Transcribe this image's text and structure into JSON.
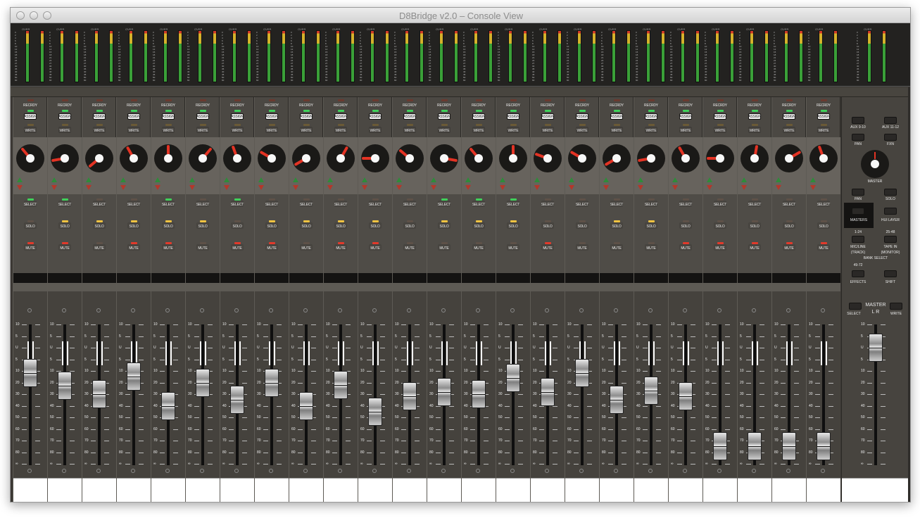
{
  "window": {
    "title": "D8Bridge v2.0 – Console View"
  },
  "meter_header_label": "OVER",
  "meter_ticks": [
    "0",
    "2",
    "4",
    "6",
    "8",
    "10",
    "12",
    "15",
    "18",
    "21",
    "24",
    "27",
    "30",
    "35",
    "40",
    "45",
    "50",
    "60"
  ],
  "buttons": {
    "recrdy": "RECRDY",
    "assign": "ASSIGN",
    "write": "WRITE",
    "select": "SELECT",
    "solo": "SOLO",
    "mute": "MUTE"
  },
  "fader_scale": [
    "10",
    "5",
    "U",
    "5",
    "10",
    "20",
    "30",
    "40",
    "50",
    "60",
    "70",
    "80",
    "∞"
  ],
  "channels": [
    {
      "knob_angle": -40,
      "fader_level_db": -12,
      "select_on": true,
      "solo_on": false,
      "mute_on": true
    },
    {
      "knob_angle": -100,
      "fader_level_db": -23,
      "select_on": true,
      "solo_on": true,
      "mute_on": true
    },
    {
      "knob_angle": -130,
      "fader_level_db": -30,
      "select_on": false,
      "solo_on": true,
      "mute_on": false
    },
    {
      "knob_angle": -30,
      "fader_level_db": -15,
      "select_on": false,
      "solo_on": true,
      "mute_on": true
    },
    {
      "knob_angle": 0,
      "fader_level_db": -40,
      "select_on": true,
      "solo_on": true,
      "mute_on": true
    },
    {
      "knob_angle": 40,
      "fader_level_db": -20,
      "select_on": false,
      "solo_on": true,
      "mute_on": false
    },
    {
      "knob_angle": -20,
      "fader_level_db": -35,
      "select_on": true,
      "solo_on": false,
      "mute_on": true
    },
    {
      "knob_angle": -60,
      "fader_level_db": -20,
      "select_on": false,
      "solo_on": true,
      "mute_on": true
    },
    {
      "knob_angle": -120,
      "fader_level_db": -40,
      "select_on": false,
      "solo_on": true,
      "mute_on": false
    },
    {
      "knob_angle": 30,
      "fader_level_db": -22,
      "select_on": false,
      "solo_on": true,
      "mute_on": true
    },
    {
      "knob_angle": -90,
      "fader_level_db": -45,
      "select_on": false,
      "solo_on": true,
      "mute_on": true
    },
    {
      "knob_angle": -50,
      "fader_level_db": -32,
      "select_on": false,
      "solo_on": false,
      "mute_on": false
    },
    {
      "knob_angle": 100,
      "fader_level_db": -28,
      "select_on": true,
      "solo_on": true,
      "mute_on": false
    },
    {
      "knob_angle": -40,
      "fader_level_db": -30,
      "select_on": true,
      "solo_on": true,
      "mute_on": false
    },
    {
      "knob_angle": 0,
      "fader_level_db": -16,
      "select_on": true,
      "solo_on": true,
      "mute_on": false
    },
    {
      "knob_angle": -70,
      "fader_level_db": -28,
      "select_on": false,
      "solo_on": false,
      "mute_on": true
    },
    {
      "knob_angle": -60,
      "fader_level_db": -12,
      "select_on": false,
      "solo_on": false,
      "mute_on": false
    },
    {
      "knob_angle": -120,
      "fader_level_db": -35,
      "select_on": false,
      "solo_on": true,
      "mute_on": false
    },
    {
      "knob_angle": -100,
      "fader_level_db": -27,
      "select_on": false,
      "solo_on": true,
      "mute_on": false
    },
    {
      "knob_angle": -30,
      "fader_level_db": -32,
      "select_on": false,
      "solo_on": false,
      "mute_on": true
    },
    {
      "knob_angle": -90,
      "fader_level_db": -75,
      "select_on": false,
      "solo_on": false,
      "mute_on": true
    },
    {
      "knob_angle": 10,
      "fader_level_db": -75,
      "select_on": false,
      "solo_on": false,
      "mute_on": true
    },
    {
      "knob_angle": 60,
      "fader_level_db": -75,
      "select_on": false,
      "solo_on": false,
      "mute_on": true
    },
    {
      "knob_angle": -20,
      "fader_level_db": -75,
      "select_on": false,
      "solo_on": false,
      "mute_on": true
    }
  ],
  "master_panel": {
    "aux_left": "AUX 9-10",
    "aux_right": "AUX 11-12",
    "pan_top": "PAN",
    "fxn": "FXN",
    "master_knob": "MASTER",
    "pan_bottom": "PAN",
    "solo_bottom": "SOLO",
    "masters": "MASTERS",
    "hui_layer": "HUI LAYER",
    "bank1_num": "1-24",
    "bank1": "MIC/LINE",
    "bank1_sub": "(TRACK)",
    "bank2_num": "25-48",
    "bank2": "TAPE IN",
    "bank2_sub": "(MONITOR)",
    "bank_select": "BANK SELECT",
    "fx_num": "49-72",
    "effects": "EFFECTS",
    "shift": "SHIFT",
    "master": "MASTER",
    "lr": "L R",
    "select": "SELECT",
    "write": "WRITE",
    "master_fader_db": 0
  },
  "colors": {
    "green": "#3fd15a",
    "yellow": "#f0c341",
    "red": "#e23a2b",
    "off": "#5e5148"
  }
}
